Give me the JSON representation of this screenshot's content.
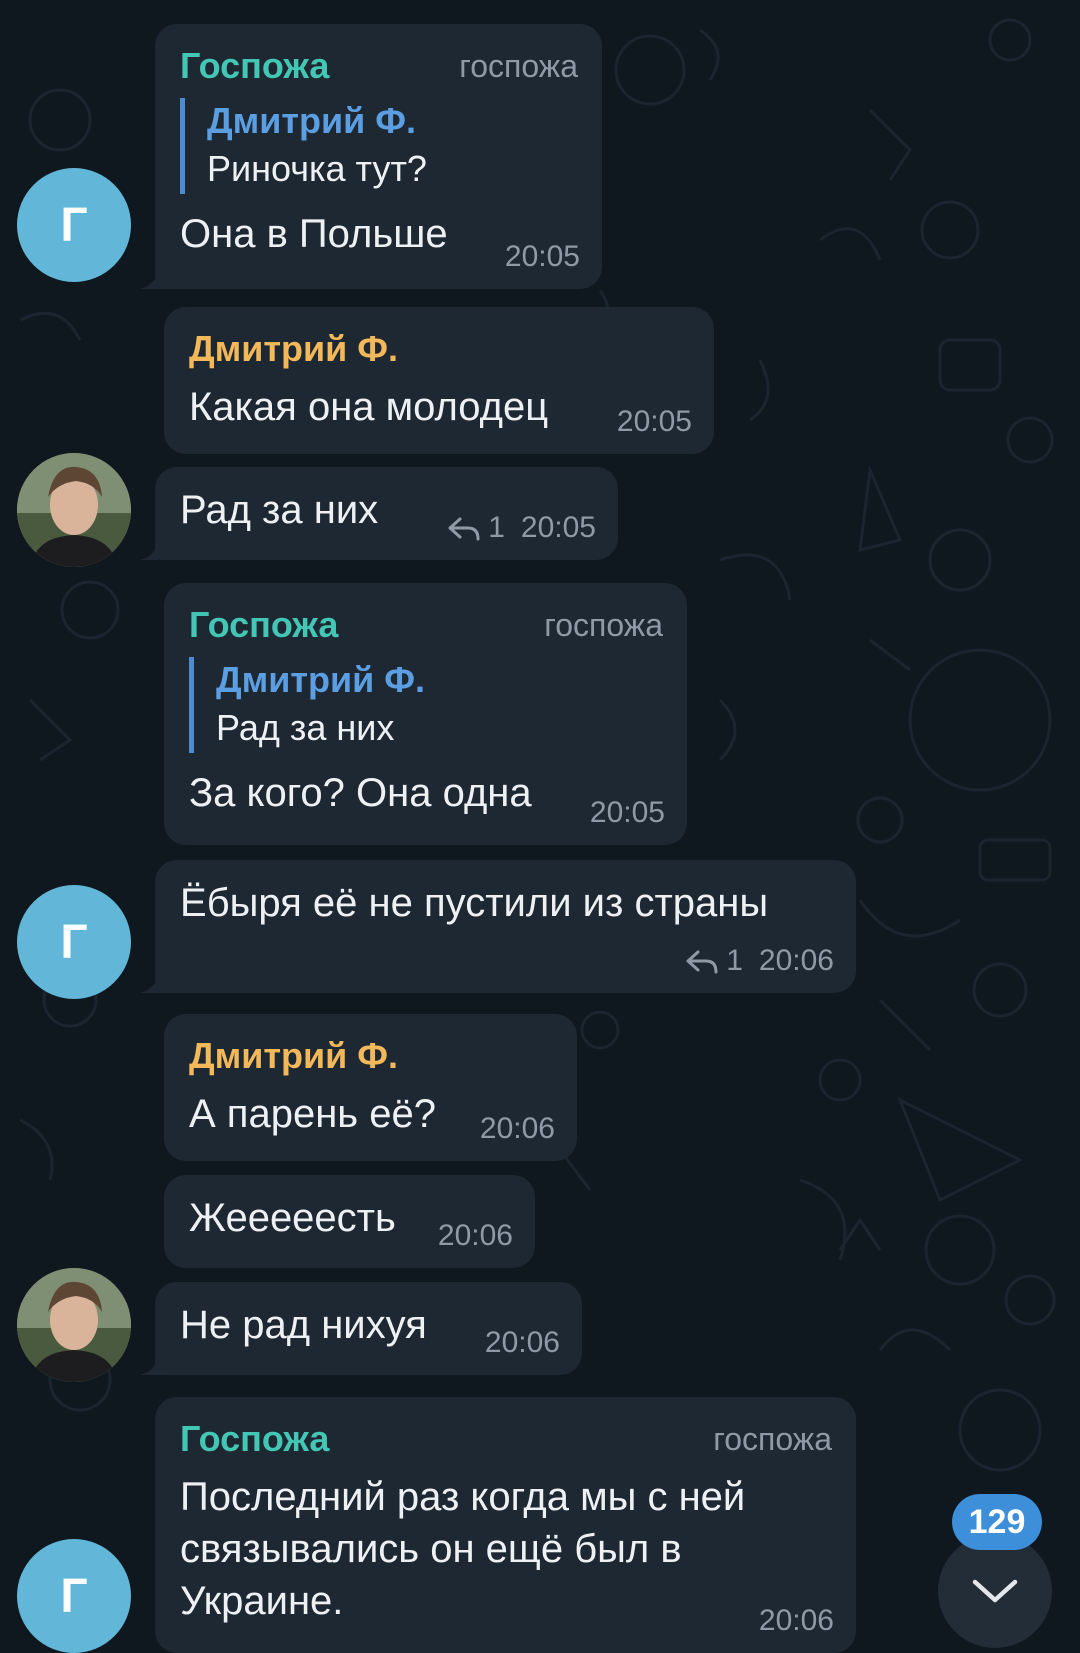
{
  "colors": {
    "background": "#0f171f",
    "bubble": "#1e2833",
    "sender_gospozha": "#43c6b4",
    "sender_dmitriy": "#f2b85a",
    "reply_accent": "#4f8bd0",
    "meta": "#8f9aa6",
    "avatar_g": "#62b7d8",
    "badge": "#3d8fd9"
  },
  "messages": [
    {
      "sender": "Госпожа",
      "role": "госпожа",
      "reply_to": {
        "name": "Дмитрий Ф.",
        "text": "Риночка тут?"
      },
      "text": "Она в Польше",
      "time": "20:05",
      "avatar": "Г"
    },
    {
      "sender": "Дмитрий Ф.",
      "text": "Какая она молодец",
      "time": "20:05"
    },
    {
      "text": "Рад за них",
      "reply_count": "1",
      "time": "20:05",
      "avatar": "photo"
    },
    {
      "sender": "Госпожа",
      "role": "госпожа",
      "reply_to": {
        "name": "Дмитрий Ф.",
        "text": "Рад за них"
      },
      "text": "За кого? Она одна",
      "time": "20:05"
    },
    {
      "text": "Ёбыря её не пустили из страны",
      "reply_count": "1",
      "time": "20:06",
      "avatar": "Г"
    },
    {
      "sender": "Дмитрий Ф.",
      "text": "А парень её?",
      "time": "20:06"
    },
    {
      "text": "Жееееесть",
      "time": "20:06"
    },
    {
      "text": "Не рад нихуя",
      "time": "20:06",
      "avatar": "photo"
    },
    {
      "sender": "Госпожа",
      "role": "госпожа",
      "text": "Последний раз когда мы с ней связывались он ещё был в Украине.",
      "time": "20:06",
      "avatar": "Г"
    }
  ],
  "unread_count": "129"
}
